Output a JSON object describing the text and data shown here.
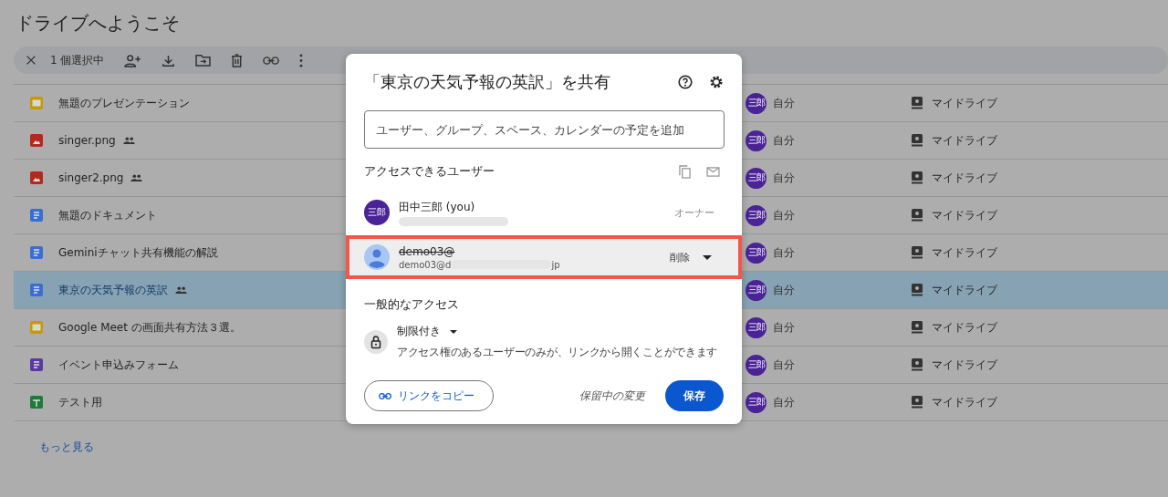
{
  "page_title": "ドライブへようこそ",
  "selection_bar": {
    "count": "1 個選択中"
  },
  "files": [
    {
      "name": "無題のプレゼンテーション",
      "kind": "slides",
      "shared": false,
      "selected": false,
      "owner_avatar": "三郎",
      "owner": "自分",
      "location": "マイドライブ"
    },
    {
      "name": "singer.png",
      "kind": "image",
      "shared": true,
      "selected": false,
      "owner_avatar": "三郎",
      "owner": "自分",
      "location": "マイドライブ"
    },
    {
      "name": "singer2.png",
      "kind": "image",
      "shared": true,
      "selected": false,
      "owner_avatar": "三郎",
      "owner": "自分",
      "location": "マイドライブ"
    },
    {
      "name": "無題のドキュメント",
      "kind": "doc",
      "shared": false,
      "selected": false,
      "owner_avatar": "三郎",
      "owner": "自分",
      "location": "マイドライブ"
    },
    {
      "name": "Geminiチャット共有機能の解説",
      "kind": "doc",
      "shared": false,
      "selected": false,
      "owner_avatar": "三郎",
      "owner": "自分",
      "location": "マイドライブ"
    },
    {
      "name": "東京の天気予報の英訳",
      "kind": "doc",
      "shared": true,
      "selected": true,
      "owner_avatar": "三郎",
      "owner": "自分",
      "location": "マイドライブ"
    },
    {
      "name": "Google Meet の画面共有方法３選。",
      "kind": "slides",
      "shared": false,
      "selected": false,
      "owner_avatar": "三郎",
      "owner": "自分",
      "location": "マイドライブ"
    },
    {
      "name": "イベント申込みフォーム",
      "kind": "form",
      "shared": false,
      "selected": false,
      "owner_avatar": "三郎",
      "owner": "自分",
      "location": "マイドライブ"
    },
    {
      "name": "テスト用",
      "kind": "sheet",
      "shared": false,
      "selected": false,
      "owner_avatar": "三郎",
      "owner": "自分",
      "location": "マイドライブ"
    }
  ],
  "more_link": "もっと見る",
  "dialog": {
    "title": "「東京の天気予報の英訳」を共有",
    "add_people": {
      "placeholder": "ユーザー、グループ、スペース、カレンダーの予定を追加"
    },
    "people_heading": "アクセスできるユーザー",
    "people": [
      {
        "kind": "initials",
        "avatar_text": "三郎",
        "name": "田中三郎 (you)",
        "removed": false,
        "highlighted": false,
        "role": "オーナー",
        "role_menu": false
      },
      {
        "kind": "silhouette",
        "name": "demo03@",
        "removed": true,
        "highlighted": true,
        "email_start": "demo03@d",
        "email_end": "jp",
        "role": "削除",
        "role_menu": true
      }
    ],
    "general_heading": "一般的なアクセス",
    "access_level": "制限付き",
    "access_description": "アクセス権のあるユーザーのみが、リンクから開くことができます",
    "copy_link": "リンクをコピー",
    "pending": "保留中の変更",
    "save": "保存"
  }
}
